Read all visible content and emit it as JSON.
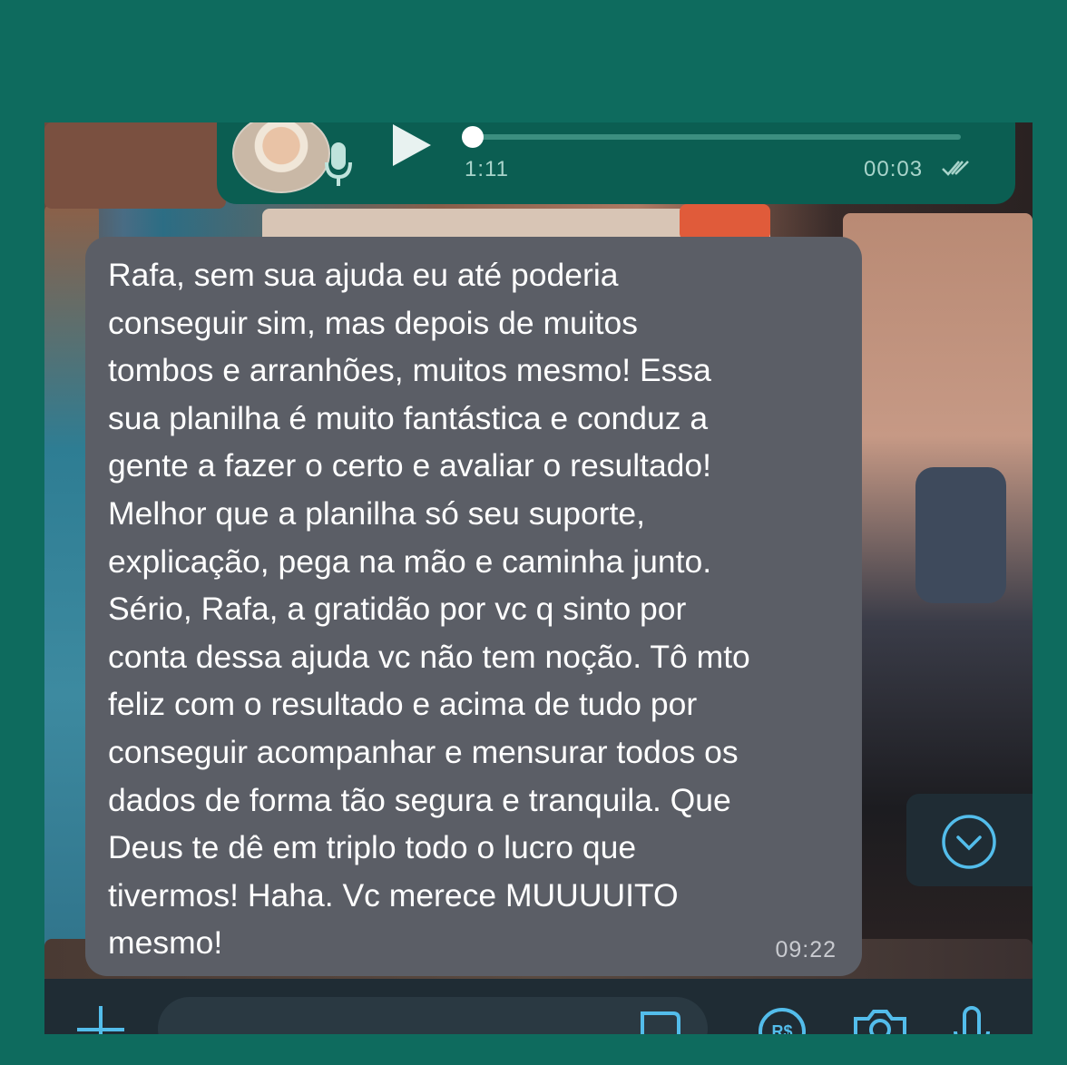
{
  "voice_message": {
    "duration": "1:11",
    "time": "00:03",
    "status": "read",
    "icons": [
      "microphone-icon",
      "play-icon",
      "double-check-icon"
    ]
  },
  "message": {
    "text": "Rafa, sem sua ajuda eu até poderia\nconseguir sim, mas depois de muitos\ntombos e arranhões, muitos mesmo! Essa\nsua planilha é muito fantástica e conduz a\ngente a fazer o certo e avaliar o resultado!\nMelhor que a planilha só seu suporte,\nexplicação, pega na mão e caminha junto.\nSério, Rafa, a gratidão por vc q sinto por\nconta dessa ajuda vc não tem noção. Tô mto\nfeliz com o resultado e acima de tudo por\nconseguir acompanhar e mensurar todos os\ndados de forma tão segura e tranquila. Que\nDeus te dê em triplo todo o lucro que\ntivermos! Haha. Vc merece MUUUUITO\nmesmo!",
    "time": "09:22"
  },
  "input_bar": {
    "icons": [
      "plus-icon",
      "sticker-icon",
      "pix-icon",
      "camera-icon",
      "microphone-icon"
    ],
    "pix_label": "R$"
  },
  "colors": {
    "background": "#0e6b5e",
    "voice_bubble": "#0b5e52",
    "message_bubble": "#5b5e66",
    "accent": "#53bdeb"
  }
}
